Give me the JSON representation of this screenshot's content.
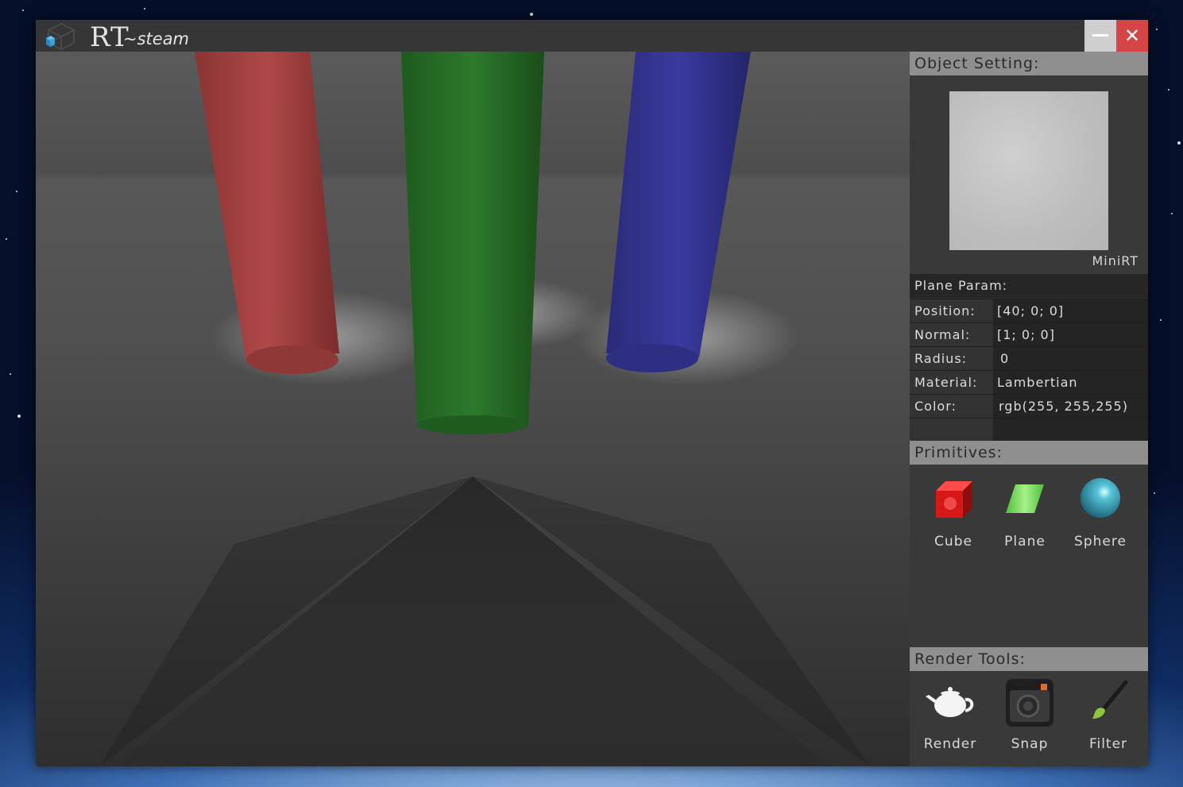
{
  "window": {
    "title": "RT",
    "subtitle": "~steam",
    "minimize_label": "",
    "close_label": "✕"
  },
  "object_setting": {
    "header": "Object Setting:",
    "preview_label": "MiniRT"
  },
  "plane_param": {
    "title": "Plane Param:",
    "rows": [
      {
        "key": "Position:",
        "value": "[40; 0; 0]"
      },
      {
        "key": "Normal:",
        "value": "[1; 0; 0]"
      },
      {
        "key": "Radius:",
        "value": "0"
      },
      {
        "key": "Material:",
        "value": "Lambertian"
      },
      {
        "key": "Color:",
        "value": "rgb(255, 255,255)"
      }
    ]
  },
  "primitives": {
    "header": "Primitives:",
    "items": [
      {
        "label": "Cube",
        "icon": "cube-icon"
      },
      {
        "label": "Plane",
        "icon": "plane-icon"
      },
      {
        "label": "Sphere",
        "icon": "sphere-icon"
      }
    ]
  },
  "render_tools": {
    "header": "Render Tools:",
    "items": [
      {
        "label": "Render",
        "icon": "teapot-icon"
      },
      {
        "label": "Snap",
        "icon": "camera-icon"
      },
      {
        "label": "Filter",
        "icon": "brush-icon"
      }
    ]
  },
  "colors": {
    "close": "#d64545",
    "minimize": "#cfcfcf",
    "header_bg": "#8f8f8f",
    "red_cylinder": "#9b3b3b",
    "green_cylinder": "#2b6b2b",
    "blue_cylinder": "#33338a"
  }
}
